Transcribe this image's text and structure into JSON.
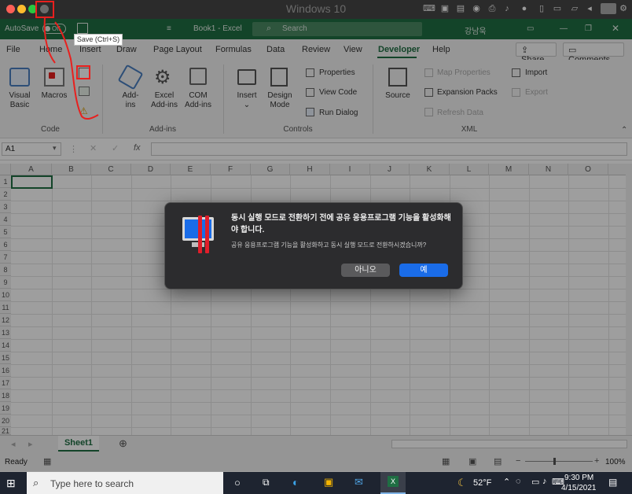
{
  "mac": {
    "title": "Windows 10"
  },
  "excel": {
    "autosave_label": "AutoSave",
    "autosave_state": "Off",
    "doc_title": "Book1 - Excel",
    "search_placeholder": "Search",
    "user_name": "강남욱",
    "save_tooltip": "Save (Ctrl+S)"
  },
  "tabs": [
    "File",
    "Home",
    "Insert",
    "Draw",
    "Page Layout",
    "Formulas",
    "Data",
    "Review",
    "View",
    "Developer",
    "Help"
  ],
  "active_tab": "Developer",
  "share_label": "Share",
  "comments_label": "Comments",
  "ribbon": {
    "visual_basic": "Visual\nBasic",
    "macros": "Macros",
    "code_group": "Code",
    "add_ins": "Add-\nins",
    "excel_add_ins": "Excel\nAdd-ins",
    "com_add_ins": "COM\nAdd-ins",
    "add_ins_group": "Add-ins",
    "insert": "Insert",
    "design_mode": "Design\nMode",
    "properties": "Properties",
    "view_code": "View Code",
    "run_dialog": "Run Dialog",
    "controls_group": "Controls",
    "source": "Source",
    "map_properties": "Map Properties",
    "expansion_packs": "Expansion Packs",
    "refresh_data": "Refresh Data",
    "import": "Import",
    "export": "Export",
    "xml_group": "XML"
  },
  "formula_bar": {
    "name_box": "A1",
    "fx": "fx"
  },
  "columns": [
    "A",
    "B",
    "C",
    "D",
    "E",
    "F",
    "G",
    "H",
    "I",
    "J",
    "K",
    "L",
    "M",
    "N",
    "O"
  ],
  "rows": [
    "1",
    "2",
    "3",
    "4",
    "5",
    "6",
    "7",
    "8",
    "9",
    "10",
    "11",
    "12",
    "13",
    "14",
    "15",
    "16",
    "17",
    "18",
    "19",
    "20",
    "21"
  ],
  "sheet_tab": "Sheet1",
  "status": {
    "ready": "Ready",
    "zoom": "100%"
  },
  "taskbar": {
    "search_placeholder": "Type here to search",
    "temperature": "52°F",
    "time": "9:30 PM",
    "date": "4/15/2021"
  },
  "dialog": {
    "title": "동시 실행 모드로 전환하기 전에 공유 응용프로그램 기능을 활성화해야 합니다.",
    "message": "공유 응용프로그램 기능을 활성화하고 동시 실행 모드로 전환하시겠습니까?",
    "no_label": "아니오",
    "yes_label": "예"
  },
  "colors": {
    "excel_green": "#1f6e43",
    "annotation_red": "#e8201e",
    "dialog_bg": "#2c2c2e",
    "yes_blue": "#1a6ce8"
  }
}
